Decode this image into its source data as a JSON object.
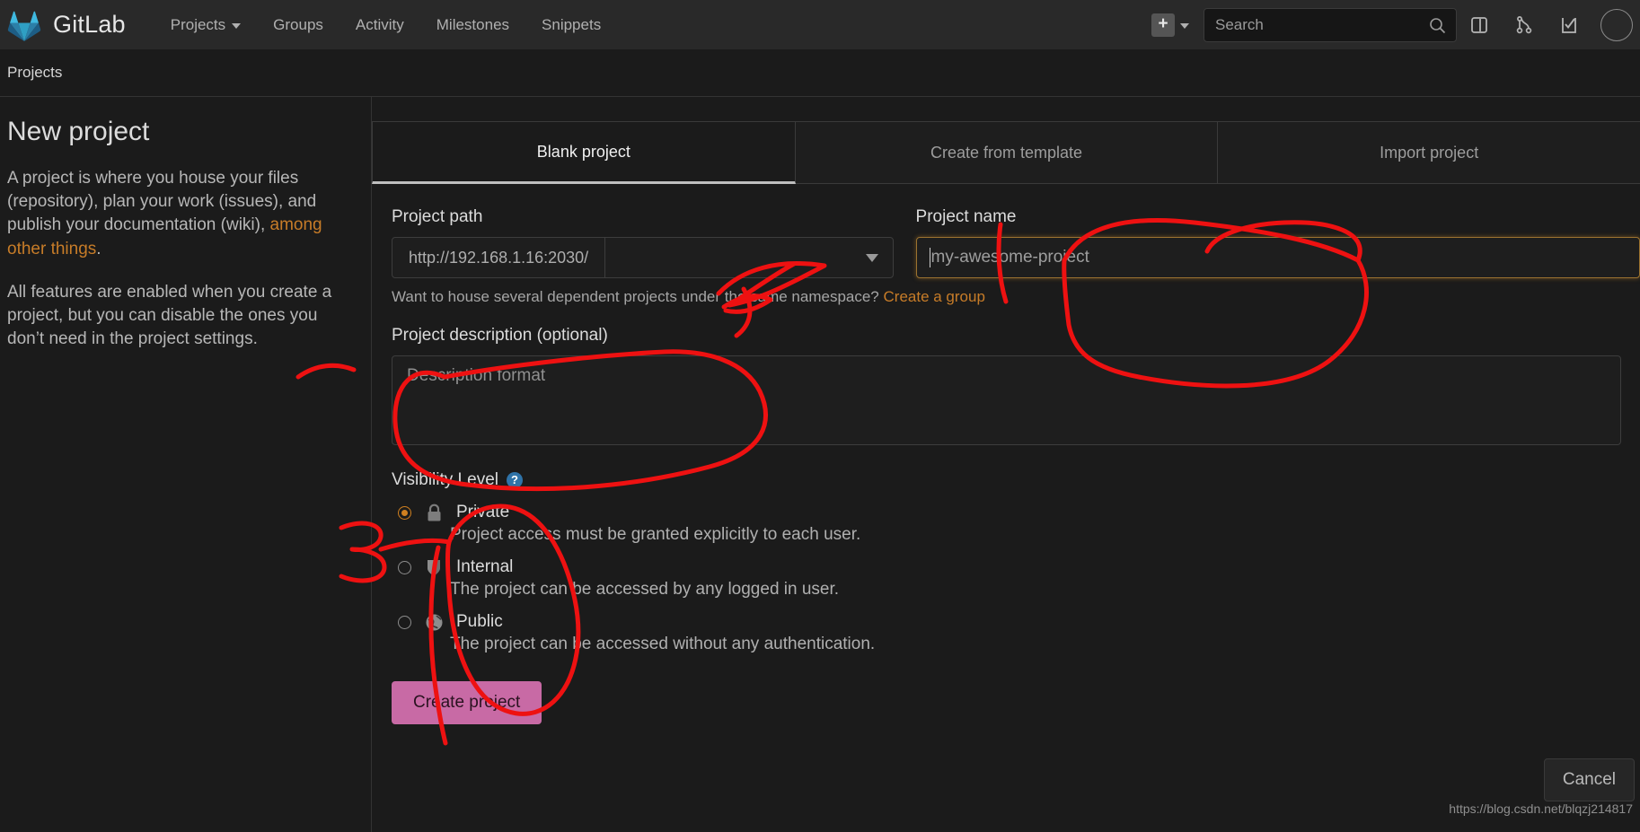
{
  "nav": {
    "brand": "GitLab",
    "links": [
      {
        "label": "Projects",
        "has_caret": true
      },
      {
        "label": "Groups",
        "has_caret": false
      },
      {
        "label": "Activity",
        "has_caret": false
      },
      {
        "label": "Milestones",
        "has_caret": false
      },
      {
        "label": "Snippets",
        "has_caret": false
      }
    ],
    "plus_label": "+",
    "search_placeholder": "Search",
    "icons": [
      "issue-board-icon",
      "merge-request-icon",
      "todos-icon",
      "avatar"
    ]
  },
  "breadcrumb": {
    "label": "Projects"
  },
  "left": {
    "title": "New project",
    "p1_before": "A project is where you house your files (repository), plan your work (issues), and publish your documentation (wiki), ",
    "p1_link": "among other things",
    "p1_after": ".",
    "p2": "All features are enabled when you create a project, but you can disable the ones you don’t need in the project settings."
  },
  "tabs": [
    {
      "label": "Blank project",
      "active": true
    },
    {
      "label": "Create from template",
      "active": false
    },
    {
      "label": "Import project",
      "active": false
    }
  ],
  "form": {
    "path_label": "Project path",
    "path_prefix": "http://192.168.1.16:2030/",
    "path_namespace_value": "",
    "name_label": "Project name",
    "name_value": "",
    "name_placeholder": "my-awesome-project",
    "hint_text": "Want to house several dependent projects under the same namespace?",
    "hint_link": "Create a group",
    "desc_label": "Project description (optional)",
    "desc_value": "",
    "desc_placeholder": "Description format",
    "visibility_label": "Visibility Level",
    "help_glyph": "?",
    "visibility_options": [
      {
        "name": "Private",
        "icon": "lock-icon",
        "selected": true,
        "description": "Project access must be granted explicitly to each user."
      },
      {
        "name": "Internal",
        "icon": "shield-icon",
        "selected": false,
        "description": "The project can be accessed by any logged in user."
      },
      {
        "name": "Public",
        "icon": "globe-icon",
        "selected": false,
        "description": "The project can be accessed without any authentication."
      }
    ],
    "create_label": "Create project",
    "cancel_label": "Cancel"
  },
  "watermark": "https://blog.csdn.net/blqzj214817",
  "colors": {
    "accent_orange": "#c77c28",
    "focus_orange": "#9c7330",
    "create_button": "#c86aa5",
    "help_blue": "#2f73a8",
    "annotation_red": "#ee1111",
    "nav_bg": "#292929",
    "page_bg": "#1b1b1b"
  }
}
